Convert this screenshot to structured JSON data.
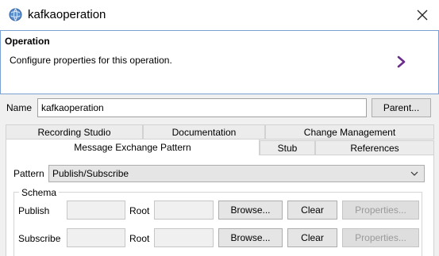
{
  "window": {
    "title": "kafkaoperation",
    "app_icon": "globe-app-icon",
    "close_icon": "close-icon"
  },
  "header": {
    "title": "Operation",
    "description": "Configure properties for this operation.",
    "arrow_icon": "chevron-right-icon",
    "arrow_color": "#6b2d8c"
  },
  "name_row": {
    "label": "Name",
    "value": "kafkaoperation",
    "parent_button": "Parent..."
  },
  "tabs": {
    "row1": [
      "Recording Studio",
      "Documentation",
      "Change Management"
    ],
    "row2": [
      "Message Exchange Pattern",
      "Stub",
      "References"
    ],
    "active": "Message Exchange Pattern"
  },
  "pattern": {
    "label": "Pattern",
    "value": "Publish/Subscribe"
  },
  "schema": {
    "label": "Schema",
    "rows": [
      {
        "label": "Publish",
        "root_label": "Root",
        "browse": "Browse...",
        "clear": "Clear",
        "properties": "Properties..."
      },
      {
        "label": "Subscribe",
        "root_label": "Root",
        "browse": "Browse...",
        "clear": "Clear",
        "properties": "Properties..."
      }
    ]
  }
}
